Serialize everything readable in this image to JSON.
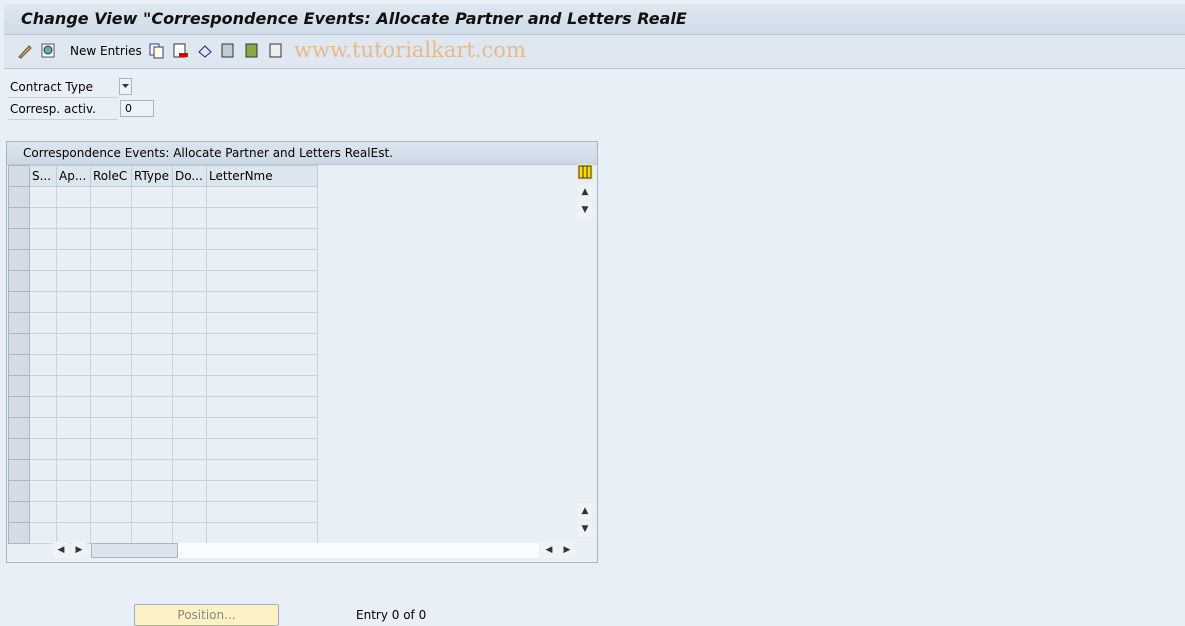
{
  "title": "Change View \"Correspondence Events: Allocate Partner and Letters RealE",
  "toolbar": {
    "new_entries": "New Entries",
    "icons": [
      "display-change-icon",
      "find-icon",
      "copy-icon",
      "delete-icon",
      "undo-icon",
      "select-all-icon",
      "select-block-icon",
      "deselect-all-icon"
    ]
  },
  "watermark": "www.tutorialkart.com",
  "fields": [
    {
      "label": "Contract Type",
      "value": ""
    },
    {
      "label": "Corresp. activ.",
      "value": "0"
    }
  ],
  "table": {
    "title": "Correspondence Events: Allocate Partner and Letters RealEst.",
    "columns": [
      "S...",
      "Ap...",
      "RoleC",
      "RType",
      "Do...",
      "LetterNme"
    ],
    "rows": 17
  },
  "footer": {
    "position_button": "Position...",
    "entry_text": "Entry 0 of 0"
  }
}
